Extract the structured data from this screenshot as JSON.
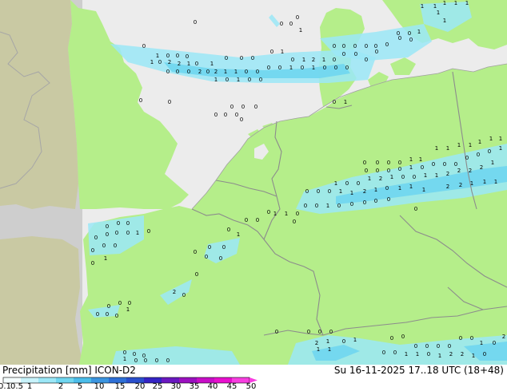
{
  "title": {
    "left": "Precipitation [mm]  ICON-D2",
    "right": "Su 16-11-2025 17..18 UTC (18+48)"
  },
  "colors": {
    "sea": "#ececec",
    "land": "#b5ee8a",
    "outside_domain": "#cecece",
    "outside_domain_land": "#c9c9a3",
    "border": "#8c8c8c",
    "coast": "#a0a0a0"
  },
  "colorbar": {
    "labels": [
      "0.1",
      "0.5",
      "1",
      "2",
      "5",
      "10",
      "15",
      "20",
      "25",
      "30",
      "35",
      "40",
      "45",
      "50"
    ],
    "colors": [
      "#f5fdff",
      "#c8f3fb",
      "#9be7f7",
      "#6fd6f0",
      "#4bbdea",
      "#3b95e0",
      "#2e6fd6",
      "#2a4fcc",
      "#3524c4",
      "#6a18c0",
      "#9b10bf",
      "#c80ec7",
      "#e80fce",
      "#f83ee0"
    ]
  },
  "precip_bands": [
    {
      "pts": [
        [
          138,
          55
        ],
        [
          235,
          65
        ],
        [
          300,
          72
        ],
        [
          360,
          66
        ],
        [
          440,
          62
        ],
        [
          470,
          72
        ],
        [
          460,
          100
        ],
        [
          410,
          104
        ],
        [
          330,
          104
        ],
        [
          265,
          102
        ],
        [
          205,
          90
        ],
        [
          160,
          78
        ]
      ],
      "level": 1
    },
    {
      "pts": [
        [
          205,
          78
        ],
        [
          265,
          86
        ],
        [
          330,
          88
        ],
        [
          380,
          86
        ],
        [
          430,
          80
        ],
        [
          438,
          92
        ],
        [
          400,
          98
        ],
        [
          330,
          98
        ],
        [
          265,
          96
        ],
        [
          215,
          90
        ]
      ],
      "level": 2
    },
    {
      "pts": [
        [
          400,
          48
        ],
        [
          470,
          40
        ],
        [
          530,
          30
        ],
        [
          540,
          52
        ],
        [
          510,
          72
        ],
        [
          460,
          76
        ],
        [
          420,
          70
        ]
      ],
      "level": 1
    },
    {
      "pts": [
        [
          525,
          5
        ],
        [
          585,
          2
        ],
        [
          590,
          22
        ],
        [
          560,
          40
        ],
        [
          530,
          30
        ]
      ],
      "level": 1
    },
    {
      "pts": [
        [
          340,
          18
        ],
        [
          350,
          30
        ],
        [
          346,
          34
        ],
        [
          336,
          22
        ]
      ],
      "level": 1
    },
    {
      "pts": [
        [
          380,
          240
        ],
        [
          440,
          222
        ],
        [
          500,
          210
        ],
        [
          560,
          196
        ],
        [
          634,
          180
        ],
        [
          634,
          238
        ],
        [
          580,
          248
        ],
        [
          520,
          254
        ],
        [
          460,
          262
        ],
        [
          400,
          268
        ],
        [
          370,
          262
        ]
      ],
      "level": 1
    },
    {
      "pts": [
        [
          420,
          246
        ],
        [
          470,
          236
        ],
        [
          530,
          226
        ],
        [
          600,
          212
        ],
        [
          634,
          208
        ],
        [
          634,
          228
        ],
        [
          580,
          236
        ],
        [
          520,
          244
        ],
        [
          460,
          252
        ],
        [
          420,
          256
        ]
      ],
      "level": 2
    },
    {
      "pts": [
        [
          110,
          280
        ],
        [
          180,
          270
        ],
        [
          180,
          300
        ],
        [
          150,
          318
        ],
        [
          112,
          320
        ]
      ],
      "level": 1
    },
    {
      "pts": [
        [
          260,
          306
        ],
        [
          300,
          298
        ],
        [
          296,
          318
        ],
        [
          270,
          330
        ],
        [
          255,
          322
        ]
      ],
      "level": 1
    },
    {
      "pts": [
        [
          200,
          370
        ],
        [
          240,
          350
        ],
        [
          236,
          366
        ],
        [
          210,
          382
        ]
      ],
      "level": 1
    },
    {
      "pts": [
        [
          110,
          388
        ],
        [
          150,
          382
        ],
        [
          146,
          396
        ],
        [
          118,
          398
        ]
      ],
      "level": 1
    },
    {
      "pts": [
        [
          145,
          440
        ],
        [
          220,
          434
        ],
        [
          290,
          440
        ],
        [
          300,
          457
        ],
        [
          140,
          457
        ]
      ],
      "level": 1
    },
    {
      "pts": [
        [
          370,
          430
        ],
        [
          410,
          420
        ],
        [
          450,
          424
        ],
        [
          500,
          432
        ],
        [
          560,
          426
        ],
        [
          634,
          420
        ],
        [
          634,
          457
        ],
        [
          360,
          457
        ]
      ],
      "level": 1
    },
    {
      "pts": [
        [
          390,
          440
        ],
        [
          430,
          432
        ],
        [
          450,
          440
        ],
        [
          420,
          452
        ],
        [
          395,
          452
        ]
      ],
      "level": 2
    },
    {
      "pts": [
        [
          580,
          434
        ],
        [
          634,
          428
        ],
        [
          634,
          452
        ],
        [
          600,
          452
        ]
      ],
      "level": 2
    }
  ],
  "value_labels": [
    [
      "0",
      180,
      60
    ],
    [
      "1",
      197,
      72
    ],
    [
      "0",
      210,
      72
    ],
    [
      "0",
      222,
      72
    ],
    [
      "0",
      234,
      73
    ],
    [
      "0",
      246,
      82
    ],
    [
      "1",
      265,
      82
    ],
    [
      "0",
      283,
      75
    ],
    [
      "0",
      302,
      75
    ],
    [
      "0",
      316,
      75
    ],
    [
      "0",
      340,
      67
    ],
    [
      "1",
      353,
      67
    ],
    [
      "0",
      366,
      77
    ],
    [
      "1",
      380,
      77
    ],
    [
      "2",
      392,
      77
    ],
    [
      "1",
      405,
      77
    ],
    [
      "0",
      418,
      77
    ],
    [
      "0",
      430,
      70
    ],
    [
      "0",
      445,
      70
    ],
    [
      "0",
      458,
      77
    ],
    [
      "0",
      471,
      67
    ],
    [
      "1",
      190,
      80
    ],
    [
      "0",
      200,
      80
    ],
    [
      "2",
      212,
      80
    ],
    [
      "2",
      224,
      82
    ],
    [
      "1",
      236,
      82
    ],
    [
      "0",
      260,
      92
    ],
    [
      "2",
      270,
      92
    ],
    [
      "1",
      282,
      92
    ],
    [
      "1",
      295,
      92
    ],
    [
      "0",
      308,
      92
    ],
    [
      "0",
      322,
      92
    ],
    [
      "0",
      336,
      87
    ],
    [
      "0",
      350,
      87
    ],
    [
      "1",
      364,
      87
    ],
    [
      "0",
      378,
      87
    ],
    [
      "1",
      392,
      87
    ],
    [
      "0",
      406,
      87
    ],
    [
      "0",
      420,
      87
    ],
    [
      "0",
      434,
      87
    ],
    [
      "0",
      210,
      92
    ],
    [
      "0",
      222,
      92
    ],
    [
      "0",
      236,
      92
    ],
    [
      "2",
      250,
      92
    ],
    [
      "1",
      270,
      102
    ],
    [
      "0",
      284,
      102
    ],
    [
      "1",
      298,
      102
    ],
    [
      "0",
      312,
      102
    ],
    [
      "0",
      326,
      102
    ],
    [
      "0",
      418,
      60
    ],
    [
      "0",
      430,
      60
    ],
    [
      "0",
      444,
      60
    ],
    [
      "0",
      458,
      60
    ],
    [
      "0",
      470,
      60
    ],
    [
      "0",
      484,
      58
    ],
    [
      "0",
      498,
      44
    ],
    [
      "0",
      512,
      44
    ],
    [
      "1",
      524,
      42
    ],
    [
      "0",
      500,
      50
    ],
    [
      "0",
      514,
      52
    ],
    [
      "1",
      528,
      10
    ],
    [
      "1",
      544,
      10
    ],
    [
      "1",
      556,
      6
    ],
    [
      "1",
      570,
      6
    ],
    [
      "1",
      584,
      6
    ],
    [
      "1",
      548,
      18
    ],
    [
      "1",
      556,
      28
    ],
    [
      "0",
      352,
      32
    ],
    [
      "0",
      364,
      32
    ],
    [
      "0",
      372,
      24
    ],
    [
      "1",
      376,
      40
    ],
    [
      "0",
      244,
      30
    ],
    [
      "0",
      270,
      146
    ],
    [
      "0",
      282,
      146
    ],
    [
      "0",
      296,
      146
    ],
    [
      "0",
      290,
      136
    ],
    [
      "0",
      304,
      136
    ],
    [
      "0",
      320,
      136
    ],
    [
      "0",
      302,
      152
    ],
    [
      "0",
      176,
      128
    ],
    [
      "0",
      212,
      130
    ],
    [
      "0",
      418,
      130
    ],
    [
      "1",
      432,
      130
    ],
    [
      "0",
      456,
      206
    ],
    [
      "0",
      472,
      206
    ],
    [
      "0",
      486,
      206
    ],
    [
      "0",
      500,
      206
    ],
    [
      "1",
      514,
      202
    ],
    [
      "1",
      526,
      202
    ],
    [
      "1",
      546,
      188
    ],
    [
      "1",
      560,
      188
    ],
    [
      "1",
      574,
      184
    ],
    [
      "1",
      588,
      184
    ],
    [
      "1",
      600,
      180
    ],
    [
      "1",
      614,
      176
    ],
    [
      "1",
      626,
      176
    ],
    [
      "0",
      458,
      216
    ],
    [
      "0",
      472,
      216
    ],
    [
      "0",
      486,
      216
    ],
    [
      "0",
      500,
      214
    ],
    [
      "1",
      514,
      212
    ],
    [
      "0",
      528,
      212
    ],
    [
      "0",
      542,
      208
    ],
    [
      "0",
      556,
      208
    ],
    [
      "0",
      570,
      208
    ],
    [
      "0",
      584,
      200
    ],
    [
      "0",
      598,
      196
    ],
    [
      "0",
      612,
      192
    ],
    [
      "1",
      626,
      188
    ],
    [
      "1",
      420,
      232
    ],
    [
      "0",
      434,
      232
    ],
    [
      "0",
      448,
      232
    ],
    [
      "1",
      462,
      226
    ],
    [
      "2",
      476,
      226
    ],
    [
      "1",
      490,
      224
    ],
    [
      "0",
      504,
      224
    ],
    [
      "0",
      518,
      224
    ],
    [
      "1",
      532,
      222
    ],
    [
      "1",
      546,
      222
    ],
    [
      "2",
      560,
      220
    ],
    [
      "2",
      574,
      216
    ],
    [
      "2",
      588,
      216
    ],
    [
      "2",
      602,
      212
    ],
    [
      "1",
      616,
      206
    ],
    [
      "0",
      384,
      242
    ],
    [
      "0",
      398,
      242
    ],
    [
      "0",
      412,
      242
    ],
    [
      "1",
      426,
      242
    ],
    [
      "1",
      440,
      244
    ],
    [
      "2",
      456,
      242
    ],
    [
      "1",
      470,
      240
    ],
    [
      "0",
      484,
      238
    ],
    [
      "1",
      500,
      238
    ],
    [
      "1",
      514,
      236
    ],
    [
      "1",
      530,
      240
    ],
    [
      "2",
      560,
      236
    ],
    [
      "2",
      576,
      234
    ],
    [
      "1",
      590,
      232
    ],
    [
      "1",
      606,
      230
    ],
    [
      "1",
      620,
      230
    ],
    [
      "0",
      382,
      260
    ],
    [
      "0",
      396,
      260
    ],
    [
      "1",
      410,
      260
    ],
    [
      "0",
      424,
      260
    ],
    [
      "0",
      440,
      258
    ],
    [
      "0",
      456,
      256
    ],
    [
      "0",
      470,
      254
    ],
    [
      "0",
      486,
      252
    ],
    [
      "0",
      520,
      264
    ],
    [
      "0",
      336,
      268
    ],
    [
      "1",
      344,
      270
    ],
    [
      "1",
      358,
      270
    ],
    [
      "0",
      372,
      270
    ],
    [
      "0",
      322,
      278
    ],
    [
      "0",
      308,
      278
    ],
    [
      "0",
      286,
      290
    ],
    [
      "1",
      298,
      296
    ],
    [
      "0",
      368,
      280
    ],
    [
      "0",
      134,
      286
    ],
    [
      "0",
      148,
      282
    ],
    [
      "0",
      160,
      282
    ],
    [
      "0",
      120,
      300
    ],
    [
      "0",
      134,
      296
    ],
    [
      "0",
      146,
      294
    ],
    [
      "0",
      160,
      294
    ],
    [
      "1",
      172,
      294
    ],
    [
      "0",
      186,
      292
    ],
    [
      "0",
      116,
      316
    ],
    [
      "0",
      130,
      310
    ],
    [
      "0",
      144,
      310
    ],
    [
      "1",
      132,
      326
    ],
    [
      "0",
      116,
      332
    ],
    [
      "0",
      262,
      312
    ],
    [
      "0",
      276,
      326
    ],
    [
      "0",
      244,
      318
    ],
    [
      "0",
      258,
      324
    ],
    [
      "0",
      280,
      312
    ],
    [
      "2",
      218,
      368
    ],
    [
      "0",
      230,
      372
    ],
    [
      "0",
      246,
      346
    ],
    [
      "0",
      136,
      386
    ],
    [
      "0",
      150,
      382
    ],
    [
      "0",
      162,
      382
    ],
    [
      "0",
      122,
      396
    ],
    [
      "0",
      134,
      396
    ],
    [
      "0",
      146,
      398
    ],
    [
      "1",
      160,
      390
    ],
    [
      "0",
      156,
      444
    ],
    [
      "0",
      168,
      446
    ],
    [
      "0",
      180,
      448
    ],
    [
      "1",
      156,
      452
    ],
    [
      "0",
      170,
      454
    ],
    [
      "0",
      182,
      454
    ],
    [
      "0",
      196,
      454
    ],
    [
      "0",
      210,
      454
    ],
    [
      "0",
      346,
      418
    ],
    [
      "0",
      386,
      418
    ],
    [
      "0",
      400,
      418
    ],
    [
      "0",
      414,
      418
    ],
    [
      "0",
      430,
      430
    ],
    [
      "1",
      444,
      428
    ],
    [
      "2",
      396,
      432
    ],
    [
      "1",
      410,
      430
    ],
    [
      "1",
      398,
      440
    ],
    [
      "1",
      412,
      440
    ],
    [
      "0",
      490,
      426
    ],
    [
      "0",
      504,
      424
    ],
    [
      "0",
      520,
      436
    ],
    [
      "0",
      534,
      436
    ],
    [
      "0",
      548,
      436
    ],
    [
      "0",
      562,
      436
    ],
    [
      "0",
      576,
      426
    ],
    [
      "0",
      590,
      426
    ],
    [
      "1",
      602,
      432
    ],
    [
      "0",
      618,
      432
    ],
    [
      "0",
      480,
      444
    ],
    [
      "0",
      494,
      444
    ],
    [
      "1",
      508,
      446
    ],
    [
      "1",
      522,
      446
    ],
    [
      "0",
      536,
      446
    ],
    [
      "1",
      550,
      448
    ],
    [
      "2",
      564,
      446
    ],
    [
      "2",
      578,
      446
    ],
    [
      "1",
      592,
      448
    ],
    [
      "0",
      606,
      446
    ],
    [
      "2",
      630,
      424
    ]
  ]
}
